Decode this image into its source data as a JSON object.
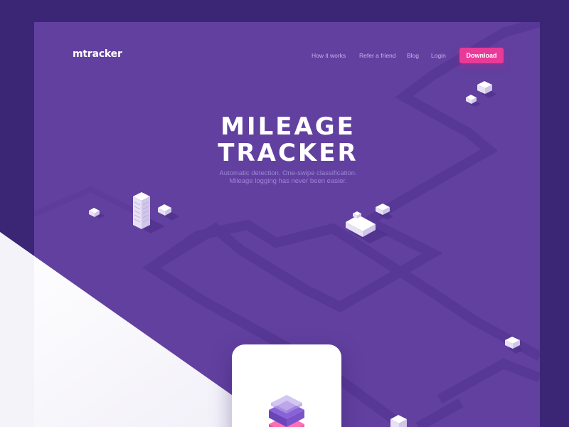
{
  "brand": {
    "logo": "mtracker"
  },
  "nav": {
    "links": [
      "How it works",
      "Refer a friend",
      "Blog",
      "Login"
    ],
    "cta": "Download"
  },
  "hero": {
    "title_line1": "MILEAGE",
    "title_line2": "TRACKER",
    "subtitle_line1": "Automatic detection. One-swipe classification.",
    "subtitle_line2": "Mileage logging has never been easier."
  },
  "colors": {
    "outer_background": "#3b2575",
    "page_background": "#6240a0",
    "road": "#5a399a",
    "accent_pink": "#ea3a98",
    "white_panel": "#f7f6fb"
  },
  "icons": [
    "app-stack-icon"
  ]
}
